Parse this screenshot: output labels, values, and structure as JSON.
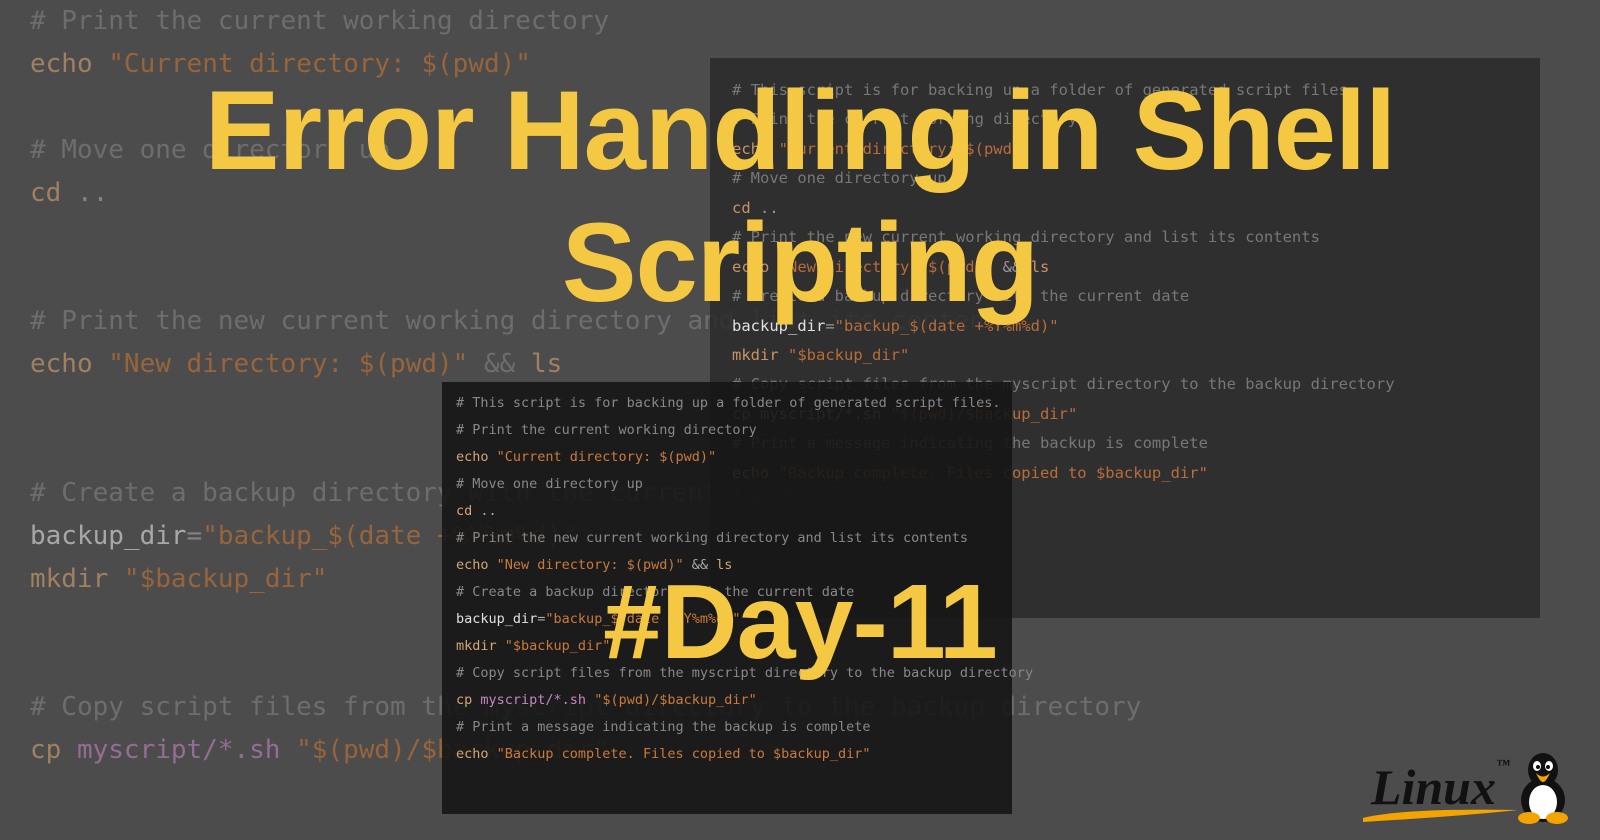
{
  "title_line1": "Error Handling in Shell",
  "title_line2": "Scripting",
  "day_label": "#Day-11",
  "bg": {
    "l0": "# Print the current working directory",
    "l1_cmd": "echo",
    "l1_str": " \"Current directory: $(pwd)\"",
    "l2": "",
    "l3": "# Move one directory up",
    "l4_cmd": "cd",
    "l4_arg": " ..",
    "l5": "",
    "l6": "# Print the new current working directory and list its contents",
    "l7_cmd": "echo",
    "l7_str": " \"New directory: $(pwd)\"",
    "l7_op": " && ",
    "l7_cmd2": "ls",
    "l8": "",
    "l9": "# Create a backup directory with the current date",
    "l10_var": "backup_dir",
    "l10_eq": "=",
    "l10_str": "\"backup_$(date +%Y%m%d)\"",
    "l11_cmd": "mkdir",
    "l11_str": " \"$backup_dir\"",
    "l12": "",
    "l13": "# Copy script files from the myscript directory to the backup directory",
    "l14_cmd": "cp",
    "l14_arg": " myscript/*.sh ",
    "l14_str": "\"$(pwd)/$backup_dir\""
  },
  "panel_right": {
    "l0": "# This script is for backing up a folder of generated script files.",
    "l1": "",
    "l2": "# Print the current working directory",
    "l3_cmd": "echo",
    "l3_str": " \"Current directory: $(pwd)\"",
    "l4": "",
    "l5": "# Move one directory up",
    "l6_cmd": "cd",
    "l6_arg": " ..",
    "l7": "",
    "l8": "# Print the new current working directory and list its contents",
    "l9_cmd": "echo",
    "l9_str": " \"New directory: $(pwd)\"",
    "l9_op": " && ",
    "l9_cmd2": "ls",
    "l10": "",
    "l11": "# Create a backup directory with the current date",
    "l12_var": "backup_dir",
    "l12_eq": "=",
    "l12_str": "\"backup_$(date +%Y%m%d)\"",
    "l13_cmd": "mkdir",
    "l13_str": " \"$backup_dir\"",
    "l14": "",
    "l15": "# Copy script files from the myscript directory to the backup directory",
    "l16_cmd": "cp",
    "l16_arg": " myscript/*.sh ",
    "l16_str": "\"$(pwd)/$backup_dir\"",
    "l17": "",
    "l18": "# Print a message indicating the backup is complete",
    "l19_cmd": "echo",
    "l19_str": " \"Backup complete. Files copied to $backup_dir\""
  },
  "panel_center": {
    "l0": "# This script is for backing up a folder of generated script files.",
    "l1": "",
    "l2": "# Print the current working directory",
    "l3_cmd": "echo",
    "l3_str": " \"Current directory: $(pwd)\"",
    "l4": "",
    "l5": "# Move one directory up",
    "l6_cmd": "cd",
    "l6_arg": " ..",
    "l7": "",
    "l8": "# Print the new current working directory and list its contents",
    "l9_cmd": "echo",
    "l9_str": " \"New directory: $(pwd)\"",
    "l9_op": " && ",
    "l9_cmd2": "ls",
    "l10": "",
    "l11": "# Create a backup directory with the current date",
    "l12_var": "backup_dir",
    "l12_eq": "=",
    "l12_str": "\"backup_$(date +%Y%m%d)\"",
    "l13_cmd": "mkdir",
    "l13_str": " \"$backup_dir\"",
    "l14": "",
    "l15": "# Copy script files from the myscript directory to the backup directory",
    "l16_cmd": "cp",
    "l16_arg": " myscript/*.sh ",
    "l16_str": "\"$(pwd)/$backup_dir\"",
    "l17": "",
    "l18": "# Print a message indicating the backup is complete",
    "l19_cmd": "echo",
    "l19_str": " \"Backup complete. Files copied to $backup_dir\""
  },
  "linux": {
    "text": "Linux"
  }
}
